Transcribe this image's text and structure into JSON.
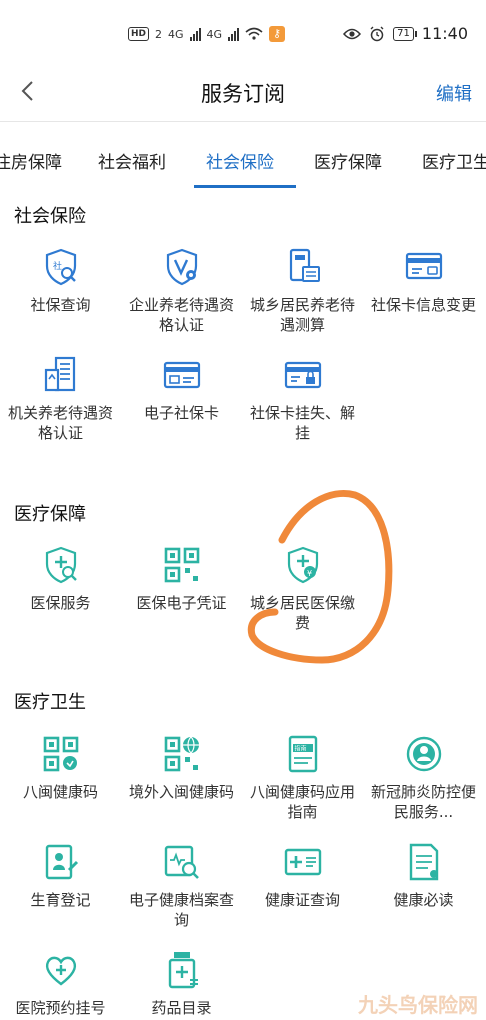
{
  "status_bar": {
    "hd": "HD",
    "sim": "2",
    "net1": "4G",
    "net2": "4G",
    "battery": "71",
    "time": "11:40"
  },
  "nav": {
    "title": "服务订阅",
    "edit": "编辑"
  },
  "tabs": [
    "住房保障",
    "社会福利",
    "社会保险",
    "医疗保障",
    "医疗卫生"
  ],
  "active_tab": "社会保险",
  "sections": [
    {
      "title": "社会保险",
      "items": [
        {
          "label": "社保查询",
          "icon": "shield-search-icon"
        },
        {
          "label": "企业养老待遇资格认证",
          "icon": "shield-v-icon"
        },
        {
          "label": "城乡居民养老待遇测算",
          "icon": "calculator-icon"
        },
        {
          "label": "社保卡信息变更",
          "icon": "card-edit-icon"
        },
        {
          "label": "机关养老待遇资格认证",
          "icon": "building-icon"
        },
        {
          "label": "电子社保卡",
          "icon": "card-icon"
        },
        {
          "label": "社保卡挂失、解挂",
          "icon": "card-lock-icon"
        }
      ]
    },
    {
      "title": "医疗保障",
      "items": [
        {
          "label": "医保服务",
          "icon": "medical-shield-search-icon"
        },
        {
          "label": "医保电子凭证",
          "icon": "qr-code-icon"
        },
        {
          "label": "城乡居民医保缴费",
          "icon": "shield-yen-icon"
        }
      ]
    },
    {
      "title": "医疗卫生",
      "items": [
        {
          "label": "八闽健康码",
          "icon": "health-qr-icon"
        },
        {
          "label": "境外入闽健康码",
          "icon": "globe-qr-icon"
        },
        {
          "label": "八闽健康码应用指南",
          "icon": "guide-book-icon"
        },
        {
          "label": "新冠肺炎防控便民服务...",
          "icon": "person-circle-icon"
        },
        {
          "label": "生育登记",
          "icon": "birth-register-icon"
        },
        {
          "label": "电子健康档案查询",
          "icon": "health-record-search-icon"
        },
        {
          "label": "健康证查询",
          "icon": "health-certificate-icon"
        },
        {
          "label": "健康必读",
          "icon": "document-icon"
        },
        {
          "label": "医院预约挂号",
          "icon": "heart-hands-icon"
        },
        {
          "label": "药品目录",
          "icon": "medicine-bottle-icon"
        }
      ]
    }
  ],
  "watermark": "九头鸟保险网",
  "colors": {
    "accent": "#1f6fc5",
    "icon_blue": "#2f7ad1",
    "icon_teal": "#2cb3a3",
    "annotation": "#f0893a"
  }
}
